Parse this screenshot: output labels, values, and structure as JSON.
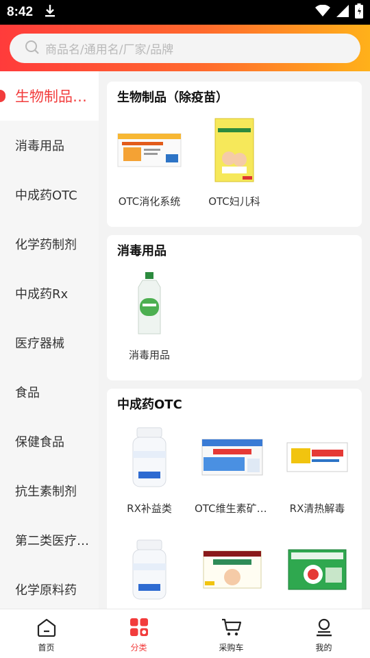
{
  "status": {
    "time": "8:42"
  },
  "search": {
    "placeholder": "商品名/通用名/厂家/品牌"
  },
  "sidebar": {
    "items": [
      {
        "label": "生物制品（除疫苗）",
        "active": true
      },
      {
        "label": "消毒用品"
      },
      {
        "label": "中成药OTC"
      },
      {
        "label": "化学药制剂"
      },
      {
        "label": "中成药Rx"
      },
      {
        "label": "医疗器械"
      },
      {
        "label": "食品"
      },
      {
        "label": "保健食品"
      },
      {
        "label": "抗生素制剂"
      },
      {
        "label": "第二类医疗器械"
      },
      {
        "label": "化学原料药"
      }
    ]
  },
  "sections": [
    {
      "title": "生物制品（除疫苗）",
      "items": [
        {
          "label": "OTC消化系统",
          "image": "white-orange-medicine-box"
        },
        {
          "label": "OTC妇儿科",
          "image": "yellow-child-medicine-box"
        }
      ]
    },
    {
      "title": "消毒用品",
      "items": [
        {
          "label": "消毒用品",
          "image": "disinfectant-bottle"
        }
      ]
    },
    {
      "title": "中成药OTC",
      "items": [
        {
          "label": "RX补益类",
          "image": "white-pill-bottle"
        },
        {
          "label": "OTC维生素矿物质",
          "image": "blue-vial-box"
        },
        {
          "label": "RX清热解毒",
          "image": "white-tablet-box"
        },
        {
          "label": "",
          "image": "white-pill-bottle"
        },
        {
          "label": "",
          "image": "child-granule-box"
        },
        {
          "label": "",
          "image": "green-granule-box"
        }
      ]
    }
  ],
  "tabbar": {
    "items": [
      {
        "label": "首页",
        "icon": "home-icon"
      },
      {
        "label": "分类",
        "icon": "category-icon",
        "active": true
      },
      {
        "label": "采购车",
        "icon": "cart-icon"
      },
      {
        "label": "我的",
        "icon": "profile-icon"
      }
    ]
  },
  "colors": {
    "accent": "#f23c3c",
    "gradient_start": "#ff3b3b",
    "gradient_end": "#ffb11a"
  }
}
